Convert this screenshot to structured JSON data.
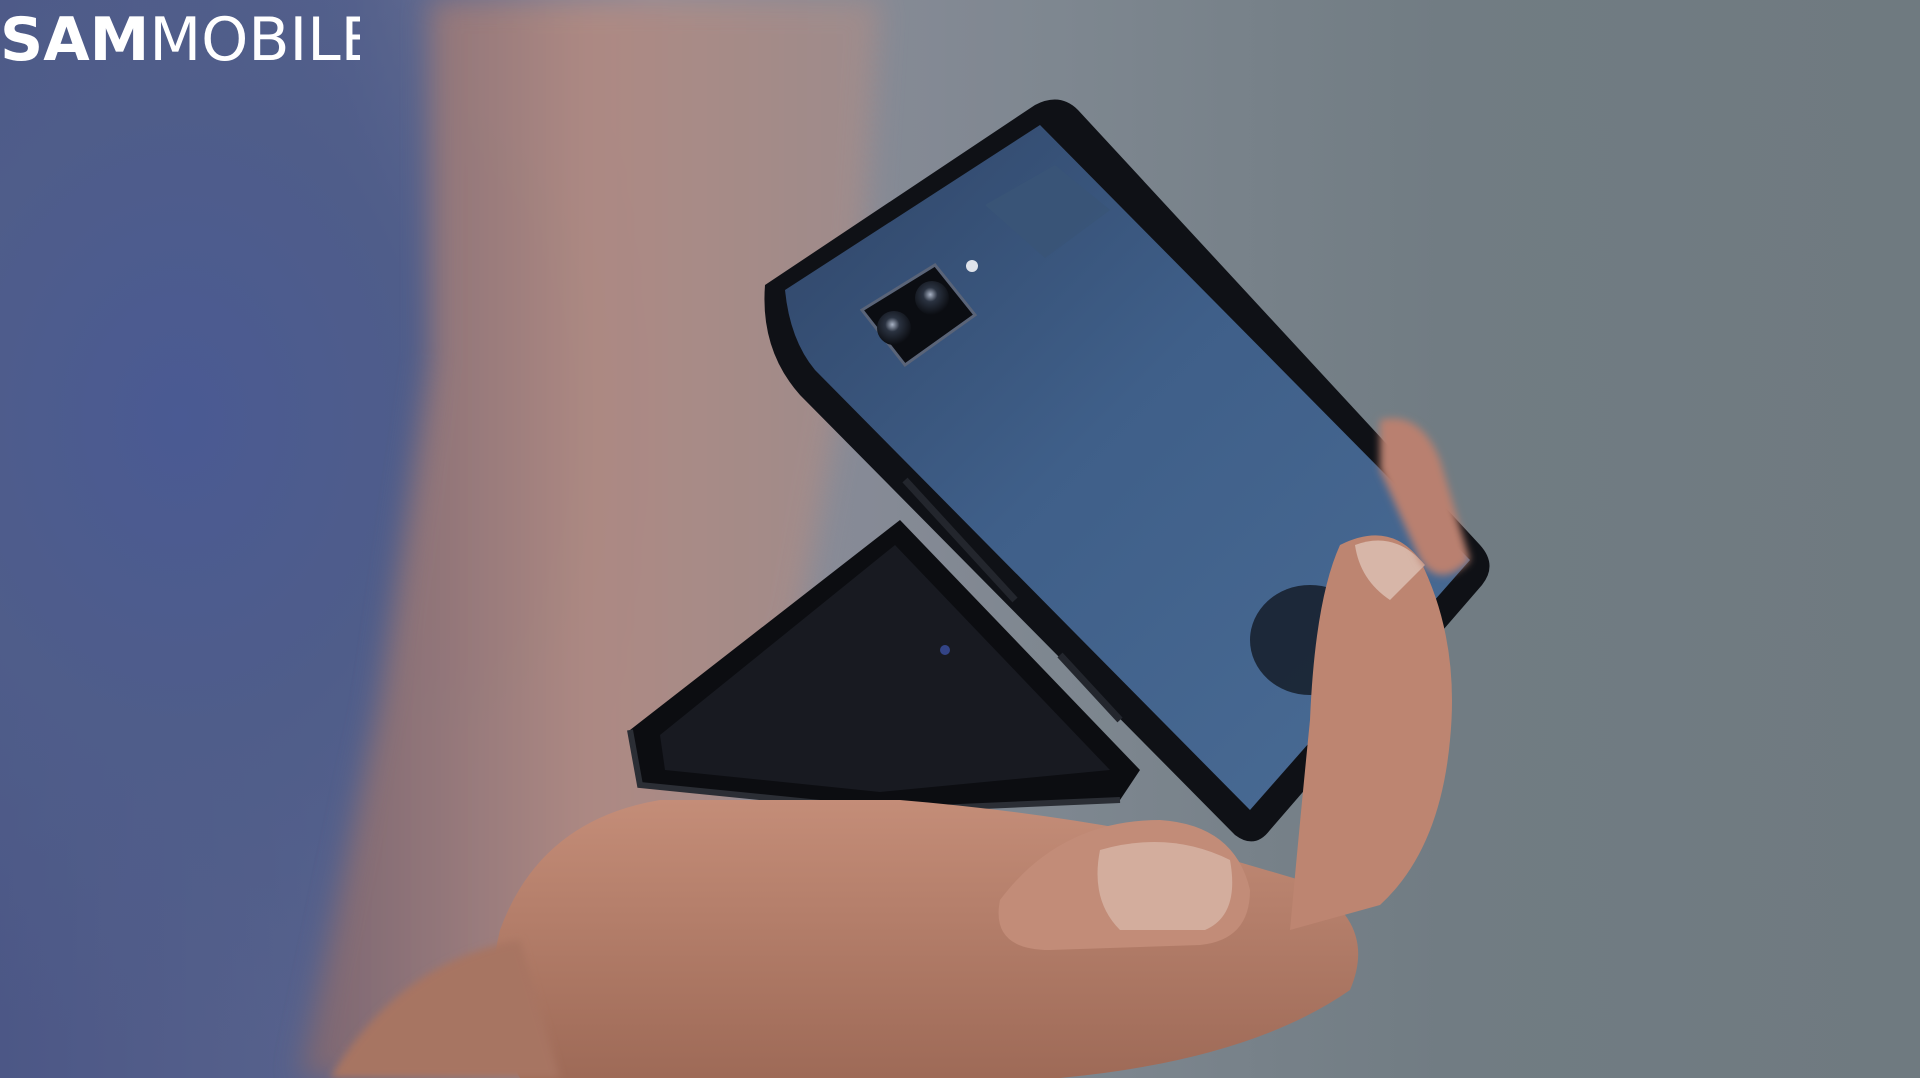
{
  "photo": {
    "subject": "folding-phone-in-hand",
    "colors": {
      "background_left": "#4d5889",
      "background_right": "#6f7a80",
      "skin": "#b98571",
      "phone_back": "#3f5f88",
      "phone_frame": "#121418"
    }
  },
  "watermark": {
    "brand_bold": "SAM",
    "brand_light": "MOBILE",
    "color": "#ffffff"
  }
}
